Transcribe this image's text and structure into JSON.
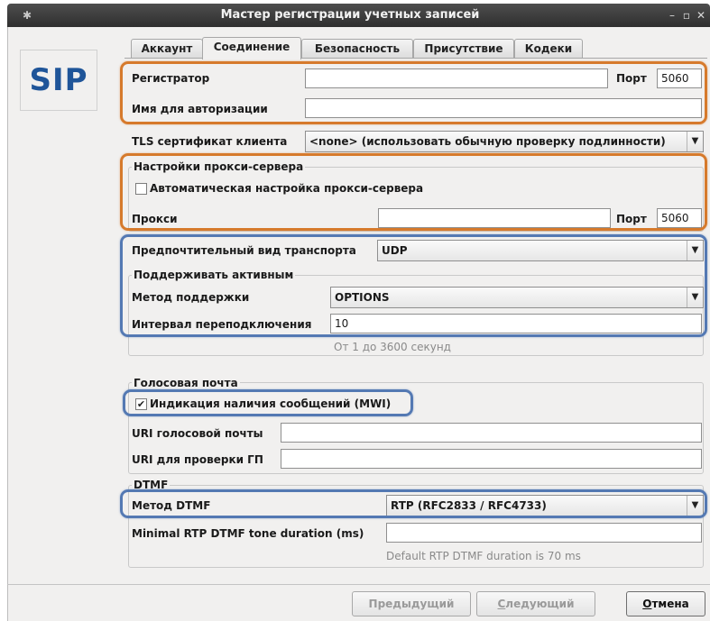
{
  "window": {
    "title": "Мастер регистрации учетных записей",
    "minimize": "–",
    "maximize": "▫",
    "close": "✕"
  },
  "logo": {
    "text": "SIP",
    "color": "#1f5599"
  },
  "tabs": [
    {
      "label": "Аккаунт",
      "active": false
    },
    {
      "label": "Соединение",
      "active": true
    },
    {
      "label": "Безопасность",
      "active": false
    },
    {
      "label": "Присутствие",
      "active": false
    },
    {
      "label": "Кодеки",
      "active": false
    }
  ],
  "registrar": {
    "label": "Регистратор",
    "value": "",
    "port_label": "Порт",
    "port_value": "5060"
  },
  "auth_name": {
    "label": "Имя для авторизации",
    "value": ""
  },
  "tls": {
    "label": "TLS сертификат клиента",
    "value": "<none> (использовать обычную проверку подлинности)"
  },
  "proxy": {
    "group_title": "Настройки прокси-сервера",
    "auto_label": "Автоматическая настройка прокси-сервера",
    "auto_checked": false,
    "label": "Прокси",
    "value": "",
    "port_label": "Порт",
    "port_value": "5060"
  },
  "transport": {
    "label": "Предпочтительный вид транспорта",
    "value": "UDP"
  },
  "keepalive": {
    "group_title": "Поддерживать активным",
    "method_label": "Метод поддержки",
    "method_value": "OPTIONS",
    "interval_label": "Интервал переподключения",
    "interval_value": "10",
    "interval_hint": "От 1 до 3600 секунд"
  },
  "voicemail": {
    "group_title": "Голосовая почта",
    "mwi_label": "Индикация наличия сообщений (MWI)",
    "mwi_checked": true,
    "uri_label": "URI голосовой почты",
    "uri_value": "",
    "check_uri_label": "URI для проверки ГП",
    "check_uri_value": ""
  },
  "dtmf": {
    "group_title": "DTMF",
    "method_label": "Метод DTMF",
    "method_value": "RTP (RFC2833 / RFC4733)",
    "duration_label": "Minimal RTP DTMF tone duration (ms)",
    "duration_value": "",
    "duration_hint": "Default RTP DTMF duration is 70 ms"
  },
  "buttons": {
    "previous": "Предыдущий",
    "next": "Следующий",
    "next_mnemonic": "С",
    "next_rest": "ледующий",
    "cancel_mnemonic": "О",
    "cancel_rest": "тмена"
  },
  "colors": {
    "highlight_orange": "#d67a2c",
    "highlight_blue": "#5479b3"
  }
}
